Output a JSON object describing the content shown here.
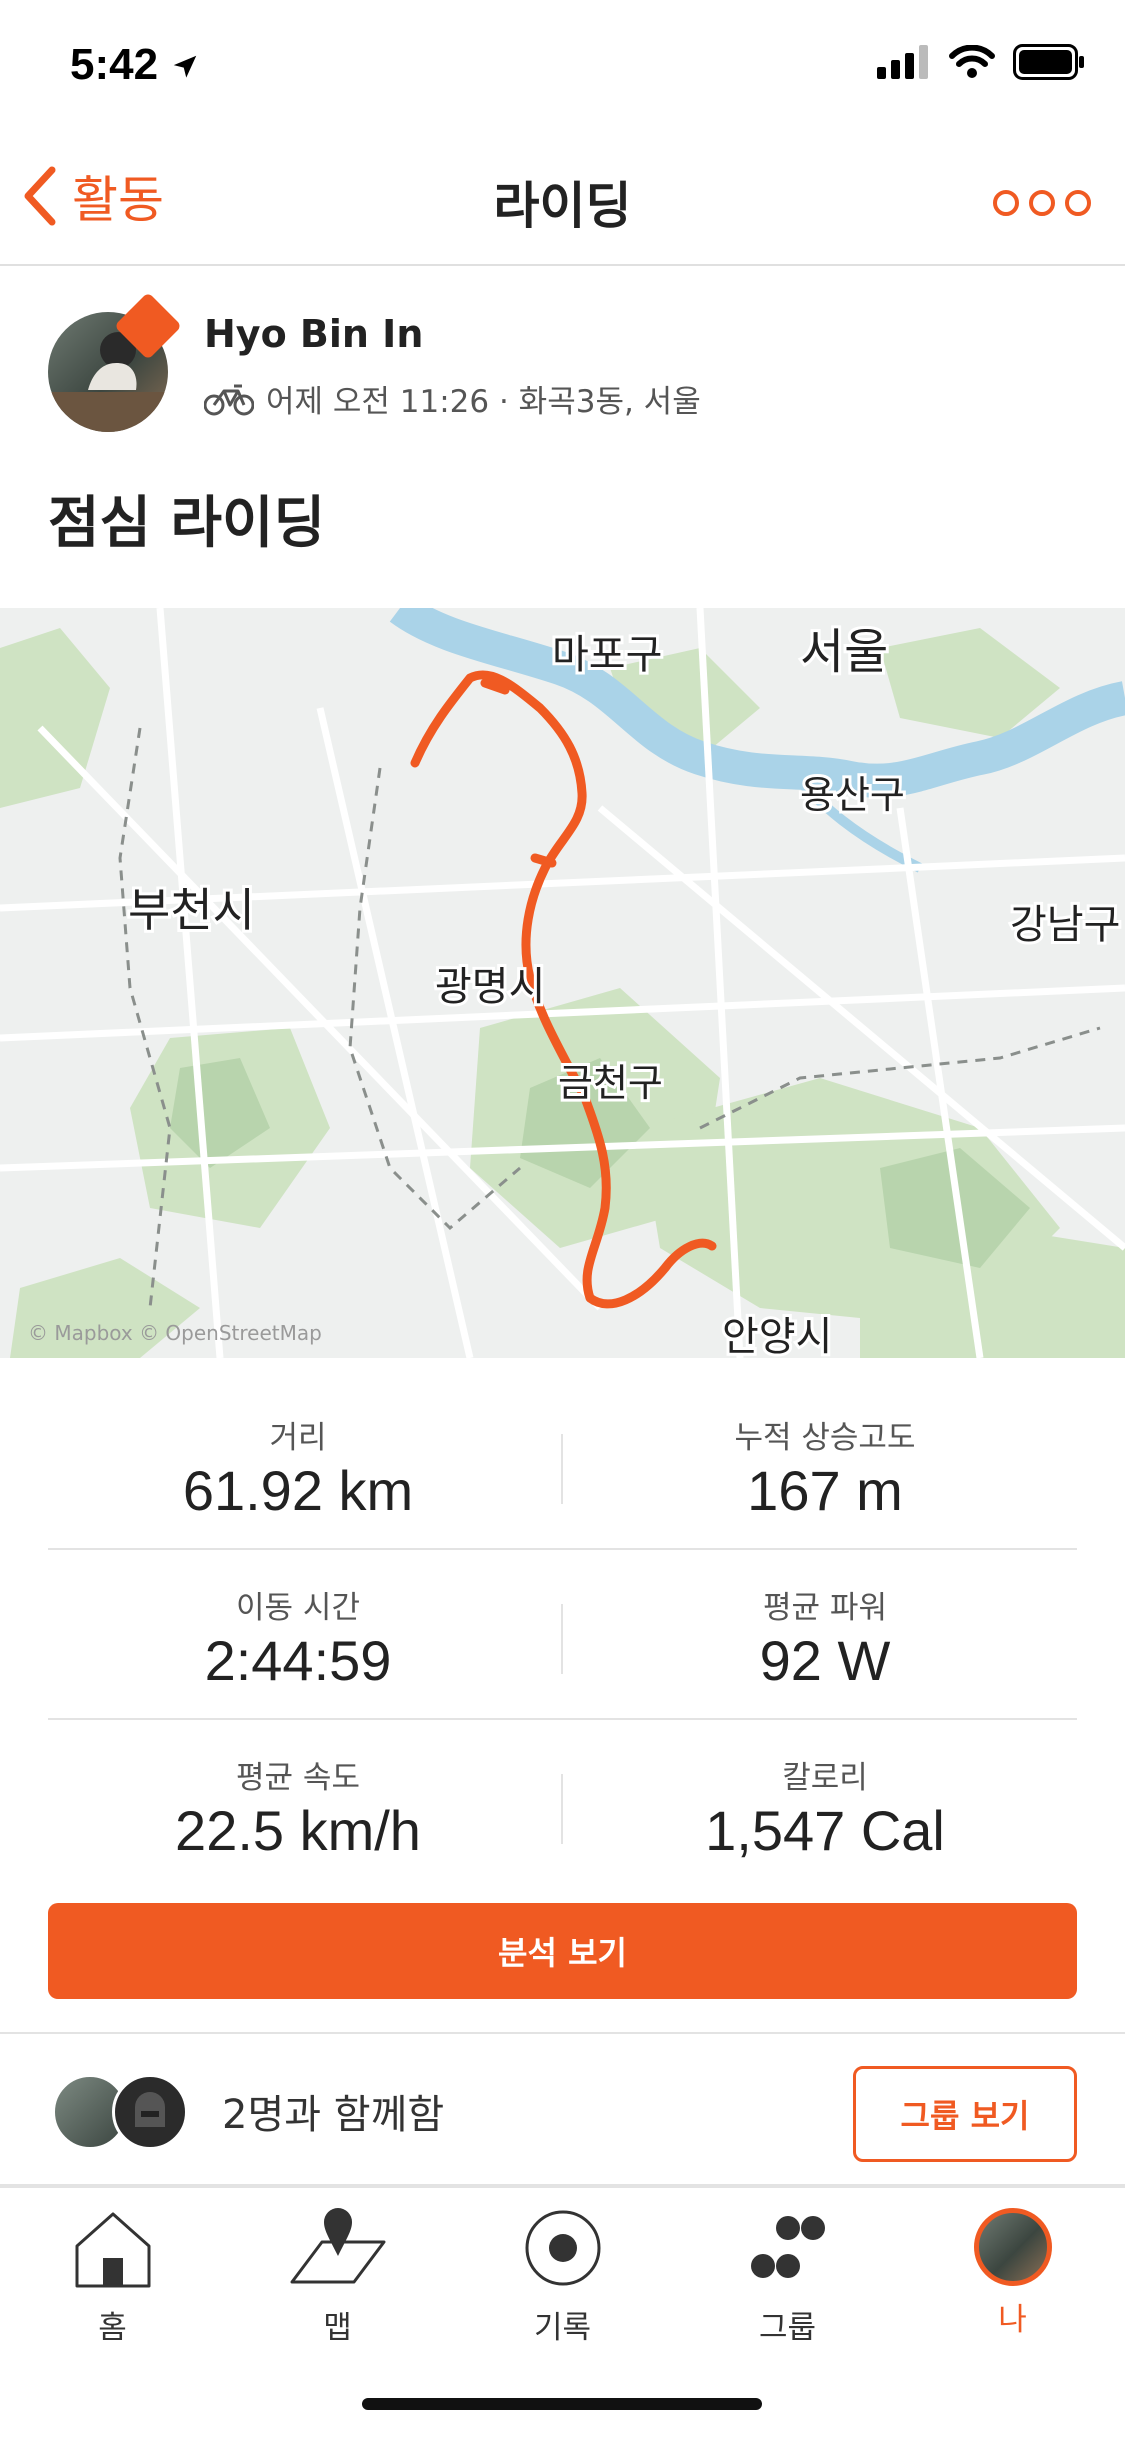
{
  "status": {
    "time": "5:42"
  },
  "nav": {
    "back_label": "활동",
    "title": "라이딩"
  },
  "athlete": {
    "name": "Hyo Bin In",
    "meta": "어제 오전 11:26 · 화곡3동, 서울"
  },
  "activity": {
    "title": "점심 라이딩"
  },
  "map": {
    "labels": [
      "마포구",
      "서울",
      "용산구",
      "부천시",
      "광명시",
      "금천구",
      "강남구",
      "안양시"
    ],
    "attribution": "© Mapbox © OpenStreetMap",
    "colors": {
      "route": "#f05a22",
      "water": "#aad3e8",
      "park": "#cfe3c3",
      "land": "#eef0ef"
    }
  },
  "stats": [
    {
      "label": "거리",
      "value": "61.92 km"
    },
    {
      "label": "누적 상승고도",
      "value": "167 m"
    },
    {
      "label": "이동 시간",
      "value": "2:44:59"
    },
    {
      "label": "평균 파워",
      "value": "92 W"
    },
    {
      "label": "평균 속도",
      "value": "22.5 km/h"
    },
    {
      "label": "칼로리",
      "value": "1,547 Cal"
    }
  ],
  "analysis_button": "분석 보기",
  "group": {
    "text": "2명과 함께함",
    "button": "그룹 보기"
  },
  "tabs": [
    {
      "label": "홈",
      "icon": "home-icon"
    },
    {
      "label": "맵",
      "icon": "map-pin-icon"
    },
    {
      "label": "기록",
      "icon": "record-icon"
    },
    {
      "label": "그룹",
      "icon": "groups-icon"
    },
    {
      "label": "나",
      "icon": "profile-avatar"
    }
  ],
  "accent_color": "#f05a22"
}
